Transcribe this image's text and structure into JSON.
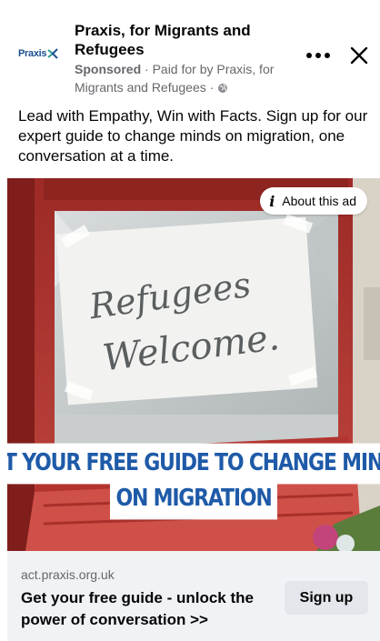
{
  "colors": {
    "brand_blue": "#1e5aa8",
    "text_primary": "#050505",
    "text_secondary": "#65676b",
    "footer_bg": "#f0f2f5",
    "button_bg": "#e4e6eb"
  },
  "header": {
    "logo_text": "Praxis",
    "page_name": "Praxis, for Migrants and Refugees",
    "sponsored_label": "Sponsored",
    "paid_for": "· Paid for by Praxis, for Migrants and Refugees ·",
    "globe_icon": "globe-icon",
    "more_icon": "more-dots-icon",
    "close_icon": "close-icon"
  },
  "post": {
    "primary_text": "Lead with Empathy, Win with Facts. Sign up for our expert guide to change minds on migration, one conversation at a time."
  },
  "image": {
    "about_ad_label": "About this ad",
    "sign_text_line1": "Refugees",
    "sign_text_line2": "Welcome.",
    "banner_line1": "GET YOUR FREE GUIDE TO CHANGE MINDS",
    "banner_line2": "ON MIGRATION"
  },
  "footer": {
    "domain": "act.praxis.org.uk",
    "headline": "Get your free guide - unlock the power of conversation >>",
    "cta_label": "Sign up"
  }
}
